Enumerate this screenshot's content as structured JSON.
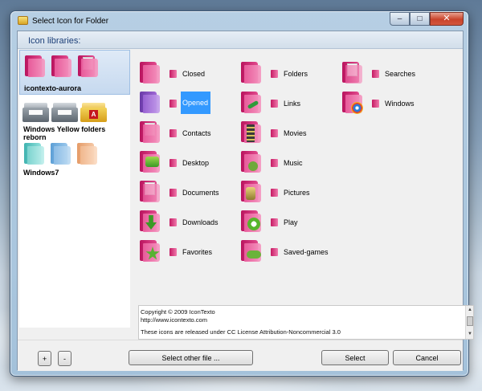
{
  "window": {
    "title": "Select Icon for Folder",
    "minimize": "–",
    "maximize": "□",
    "close": "✕"
  },
  "header": {
    "label": "Icon libraries:"
  },
  "libraries": [
    {
      "name": "icontexto-aurora",
      "selected": true
    },
    {
      "name": "Windows Yellow folders reborn",
      "selected": false
    },
    {
      "name": "Windows7",
      "selected": false
    }
  ],
  "icons": [
    {
      "label": "Closed",
      "icon": "closed-folder-icon"
    },
    {
      "label": "Folders",
      "icon": "folders-folder-icon"
    },
    {
      "label": "Searches",
      "icon": "searches-folder-icon"
    },
    {
      "label": "Opened",
      "icon": "opened-folder-icon",
      "selected": true
    },
    {
      "label": "Links",
      "icon": "links-folder-icon"
    },
    {
      "label": "Windows",
      "icon": "windows-folder-icon"
    },
    {
      "label": "Contacts",
      "icon": "contacts-folder-icon"
    },
    {
      "label": "Movies",
      "icon": "movies-folder-icon"
    },
    {
      "label": "Desktop",
      "icon": "desktop-folder-icon"
    },
    {
      "label": "Music",
      "icon": "music-folder-icon"
    },
    {
      "label": "Documents",
      "icon": "documents-folder-icon"
    },
    {
      "label": "Pictures",
      "icon": "pictures-folder-icon"
    },
    {
      "label": "Downloads",
      "icon": "downloads-folder-icon"
    },
    {
      "label": "Play",
      "icon": "play-folder-icon"
    },
    {
      "label": "Favorites",
      "icon": "favorites-folder-icon"
    },
    {
      "label": "Saved-games",
      "icon": "saved-games-folder-icon"
    }
  ],
  "info": {
    "line1": "Copyright © 2009 IconTexto",
    "line2": "http://www.icontexto.com",
    "line3": "These icons are released under CC License Attribution-Noncommercial 3.0"
  },
  "buttons": {
    "add": "+",
    "remove": "-",
    "select_other": "Select other file ...",
    "select": "Select",
    "cancel": "Cancel"
  },
  "colors": {
    "selection": "#3399ff",
    "header_text": "#1c3f78",
    "accent_pink": "#e24b8e"
  }
}
